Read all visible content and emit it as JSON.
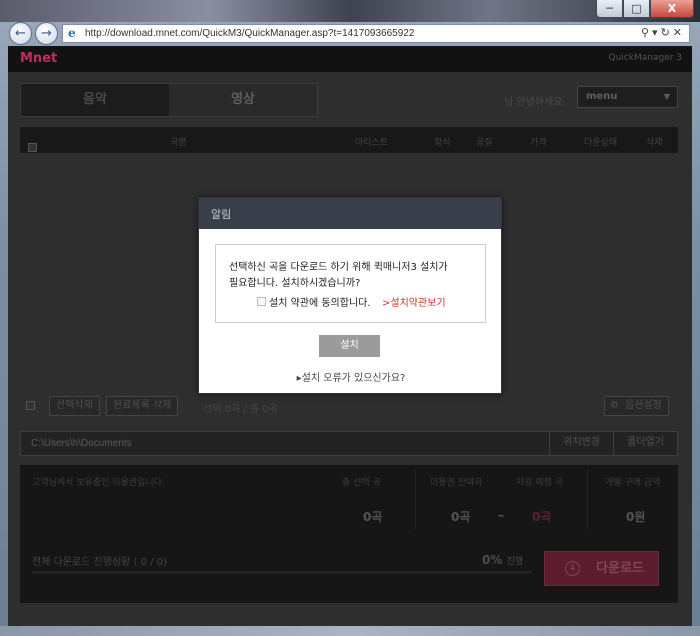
{
  "browser": {
    "url": "http://download.mnet.com/QuickM3/QuickManager.asp?t=1417093665922",
    "back_icon": "back-arrow-icon",
    "forward_icon": "forward-arrow-icon",
    "minimize": "─",
    "maximize": "□",
    "close": "X"
  },
  "app": {
    "logo": "Mnet",
    "title": "QuickManager 3",
    "tabs": [
      "음악",
      "영상"
    ],
    "greeting": "님 안녕하세요.",
    "menu_value": "menu",
    "columns": [
      "곡명",
      "아티스트",
      "형식",
      "음질",
      "가격",
      "다운상태",
      "삭제"
    ]
  },
  "tools": {
    "delete_selected": "선택삭제",
    "delete_done": "완료목록 삭제",
    "selection": "선택 0곡 / 총 0곡",
    "options": "옵션설정"
  },
  "path": {
    "value": "C:\\Users\\h\\Documents",
    "change_button": "위치변경",
    "open_button": "폴더열기"
  },
  "stats": {
    "voucher_note": "고객님께서 보유중인 이용권입니다.",
    "headers": [
      "총 선택 곡",
      "이용권 잔여곡",
      "차감 예정 곡",
      "개별 구매 금액"
    ],
    "values": [
      "0곡",
      "0곡",
      "0곡",
      "0원"
    ],
    "dash": "–",
    "progress_label": "전체 다운로드 진행상황 ( 0 / 0)",
    "progress_percent": "0%",
    "progress_suffix": "진행",
    "progress_fraction": 0,
    "download_button": "다운로드"
  },
  "dialog": {
    "title": "알림",
    "message_line1": "선택하신 곡을 다운로드 하기 위해 퀵매니저3 설치가",
    "message_line2": "필요합니다. 설치하시겠습니까?",
    "agree_label": "설치 약관에 동의합니다.",
    "terms_link": ">설치약관보기",
    "install_button": "설치",
    "error_link": "▸설치 오류가 있으신가요?"
  },
  "colors": {
    "accent": "#d9322a",
    "dialog_header": "#3a3e4a",
    "download_button": "#5e1c2f"
  }
}
